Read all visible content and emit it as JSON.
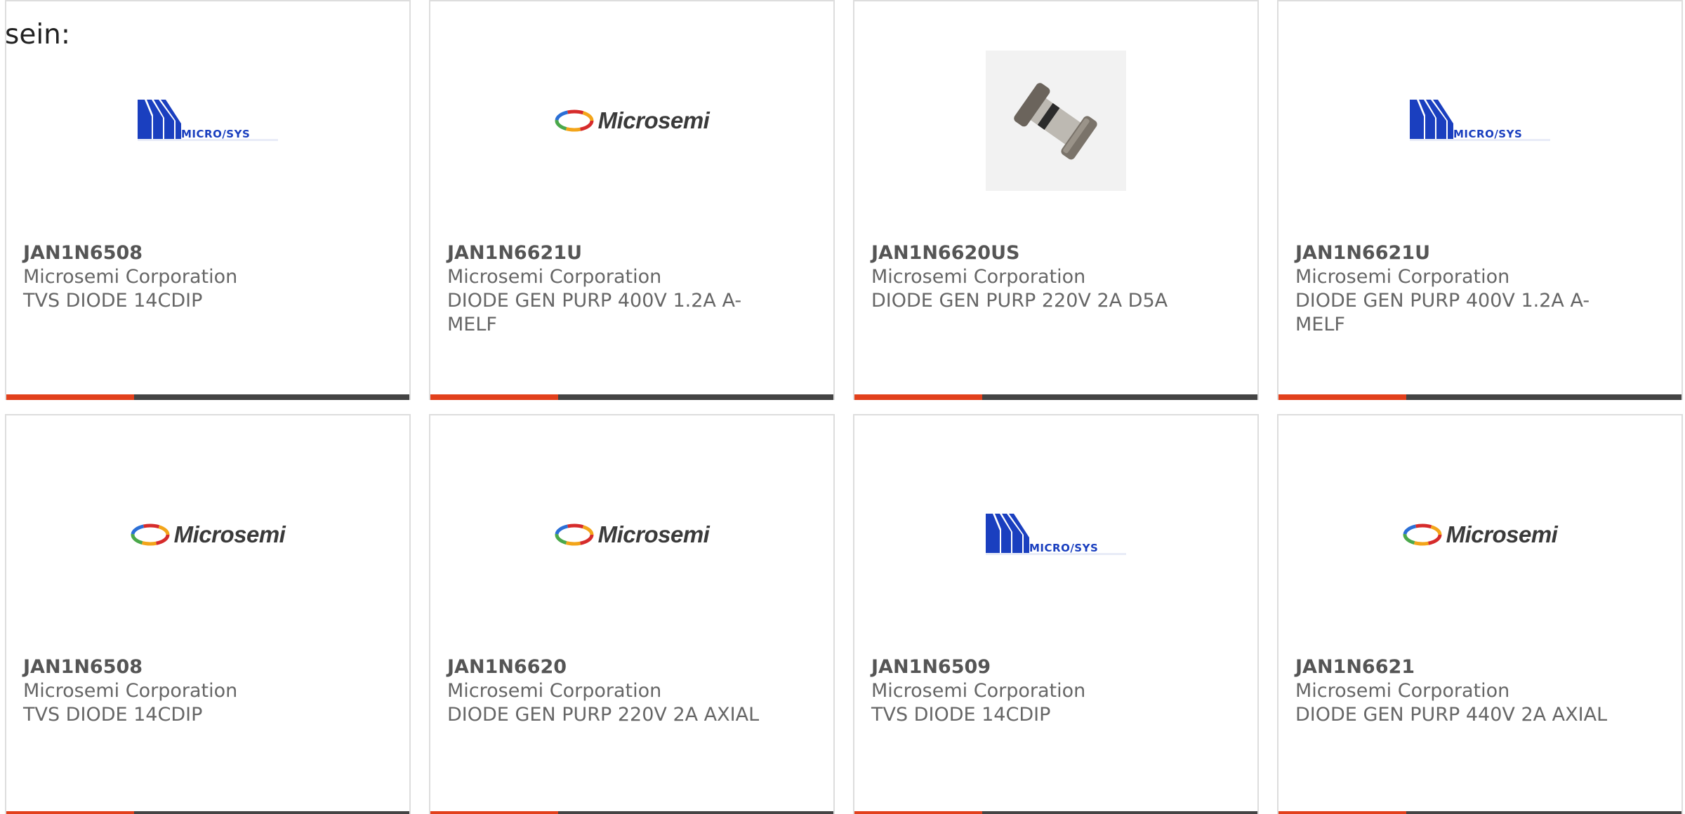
{
  "intro_text": "sein:",
  "accent_color": "#e2401c",
  "bar_color": "#444444",
  "cards": [
    {
      "part": "JAN1N6508",
      "manufacturer": "Microsemi Corporation",
      "description": "TVS DIODE 14CDIP",
      "logo": "micro-sys-logo"
    },
    {
      "part": "JAN1N6621U",
      "manufacturer": "Microsemi Corporation",
      "description": "DIODE GEN PURP 400V 1.2A A-MELF",
      "logo": "microsemi-logo"
    },
    {
      "part": "JAN1N6620US",
      "manufacturer": "Microsemi Corporation",
      "description": "DIODE GEN PURP 220V 2A D5A",
      "logo": "diode-photo"
    },
    {
      "part": "JAN1N6621U",
      "manufacturer": "Microsemi Corporation",
      "description": "DIODE GEN PURP 400V 1.2A A-MELF",
      "logo": "micro-sys-logo"
    },
    {
      "part": "JAN1N6508",
      "manufacturer": "Microsemi Corporation",
      "description": "TVS DIODE 14CDIP",
      "logo": "microsemi-logo"
    },
    {
      "part": "JAN1N6620",
      "manufacturer": "Microsemi Corporation",
      "description": "DIODE GEN PURP 220V 2A AXIAL",
      "logo": "microsemi-logo"
    },
    {
      "part": "JAN1N6509",
      "manufacturer": "Microsemi Corporation",
      "description": "TVS DIODE 14CDIP",
      "logo": "micro-sys-logo"
    },
    {
      "part": "JAN1N6621",
      "manufacturer": "Microsemi Corporation",
      "description": "DIODE GEN PURP 440V 2A AXIAL",
      "logo": "microsemi-logo"
    }
  ],
  "logo_words": {
    "micro_sys": "MICRO/SYS",
    "microsemi": "Microsemi"
  }
}
